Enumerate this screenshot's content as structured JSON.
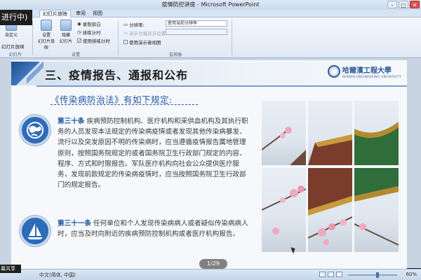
{
  "window": {
    "title": "疫情防控讲座 - Microsoft PowerPoint",
    "minimize": "–",
    "maximize": "□",
    "close": "✕"
  },
  "overlay": {
    "recording": "进行中)",
    "share": "幕共享"
  },
  "ribbon": {
    "tabs": [
      "幻灯片放映",
      "审阅",
      "视图"
    ],
    "active_tab": 0,
    "groups": {
      "start": {
        "label": "幻灯片",
        "btn1": "自定义",
        "btn2": "幻灯片放映"
      },
      "setup": {
        "label": "设置",
        "big_setup": "设置",
        "big_setup2": "幻灯片放映",
        "big_hide": "隐藏",
        "big_hide2": "幻灯片",
        "record": "录制旁白",
        "rehearse": "排练计时",
        "use_timings": "使用排练计时"
      },
      "monitor": {
        "label": "监视器",
        "resolution_label": "分辨率:",
        "resolution_value": "使用当前分辨率",
        "show_on": "演示文稿显示位置:",
        "presenter_view": "使用演示者视图"
      }
    }
  },
  "slide": {
    "title": "三、疫情报告、通报和公布",
    "logo_name": "哈爾濱工程大學",
    "logo_sub": "HARBIN ENGINEERING UNIVERSITY",
    "law_heading": "《传染病防治法》有如下规定:",
    "article30": {
      "label": "第三十条",
      "text": "疾病预防控制机构、医疗机构和采供血机构及其执行职务的人员发现本法规定的传染病疫情或者发现其他传染病暴发、流行以及突发原因不明的传染病时，应当遵循疫情报告属地管理原则，按照国务院规定的或者国务院卫生行政部门规定的内容、程序、方式和时限报告。军队医疗机构向社会公众提供医疗服务，发现前款规定的传染病疫情时，应当按照国务院卫生行政部门的规定报告。"
    },
    "article31": {
      "label": "第三十一条",
      "text": "任何单位和个人发现传染病病人或者疑似传染病病人时，应当及时向附近的疾病预防控制机构或者医疗机构报告。"
    },
    "icons": [
      "globe-icon",
      "sailboat-icon"
    ]
  },
  "status": {
    "page_indicator": "1/29",
    "language": "中文(简体, 中国)",
    "zoom": "60%",
    "zoom_fraction": 0.6
  }
}
